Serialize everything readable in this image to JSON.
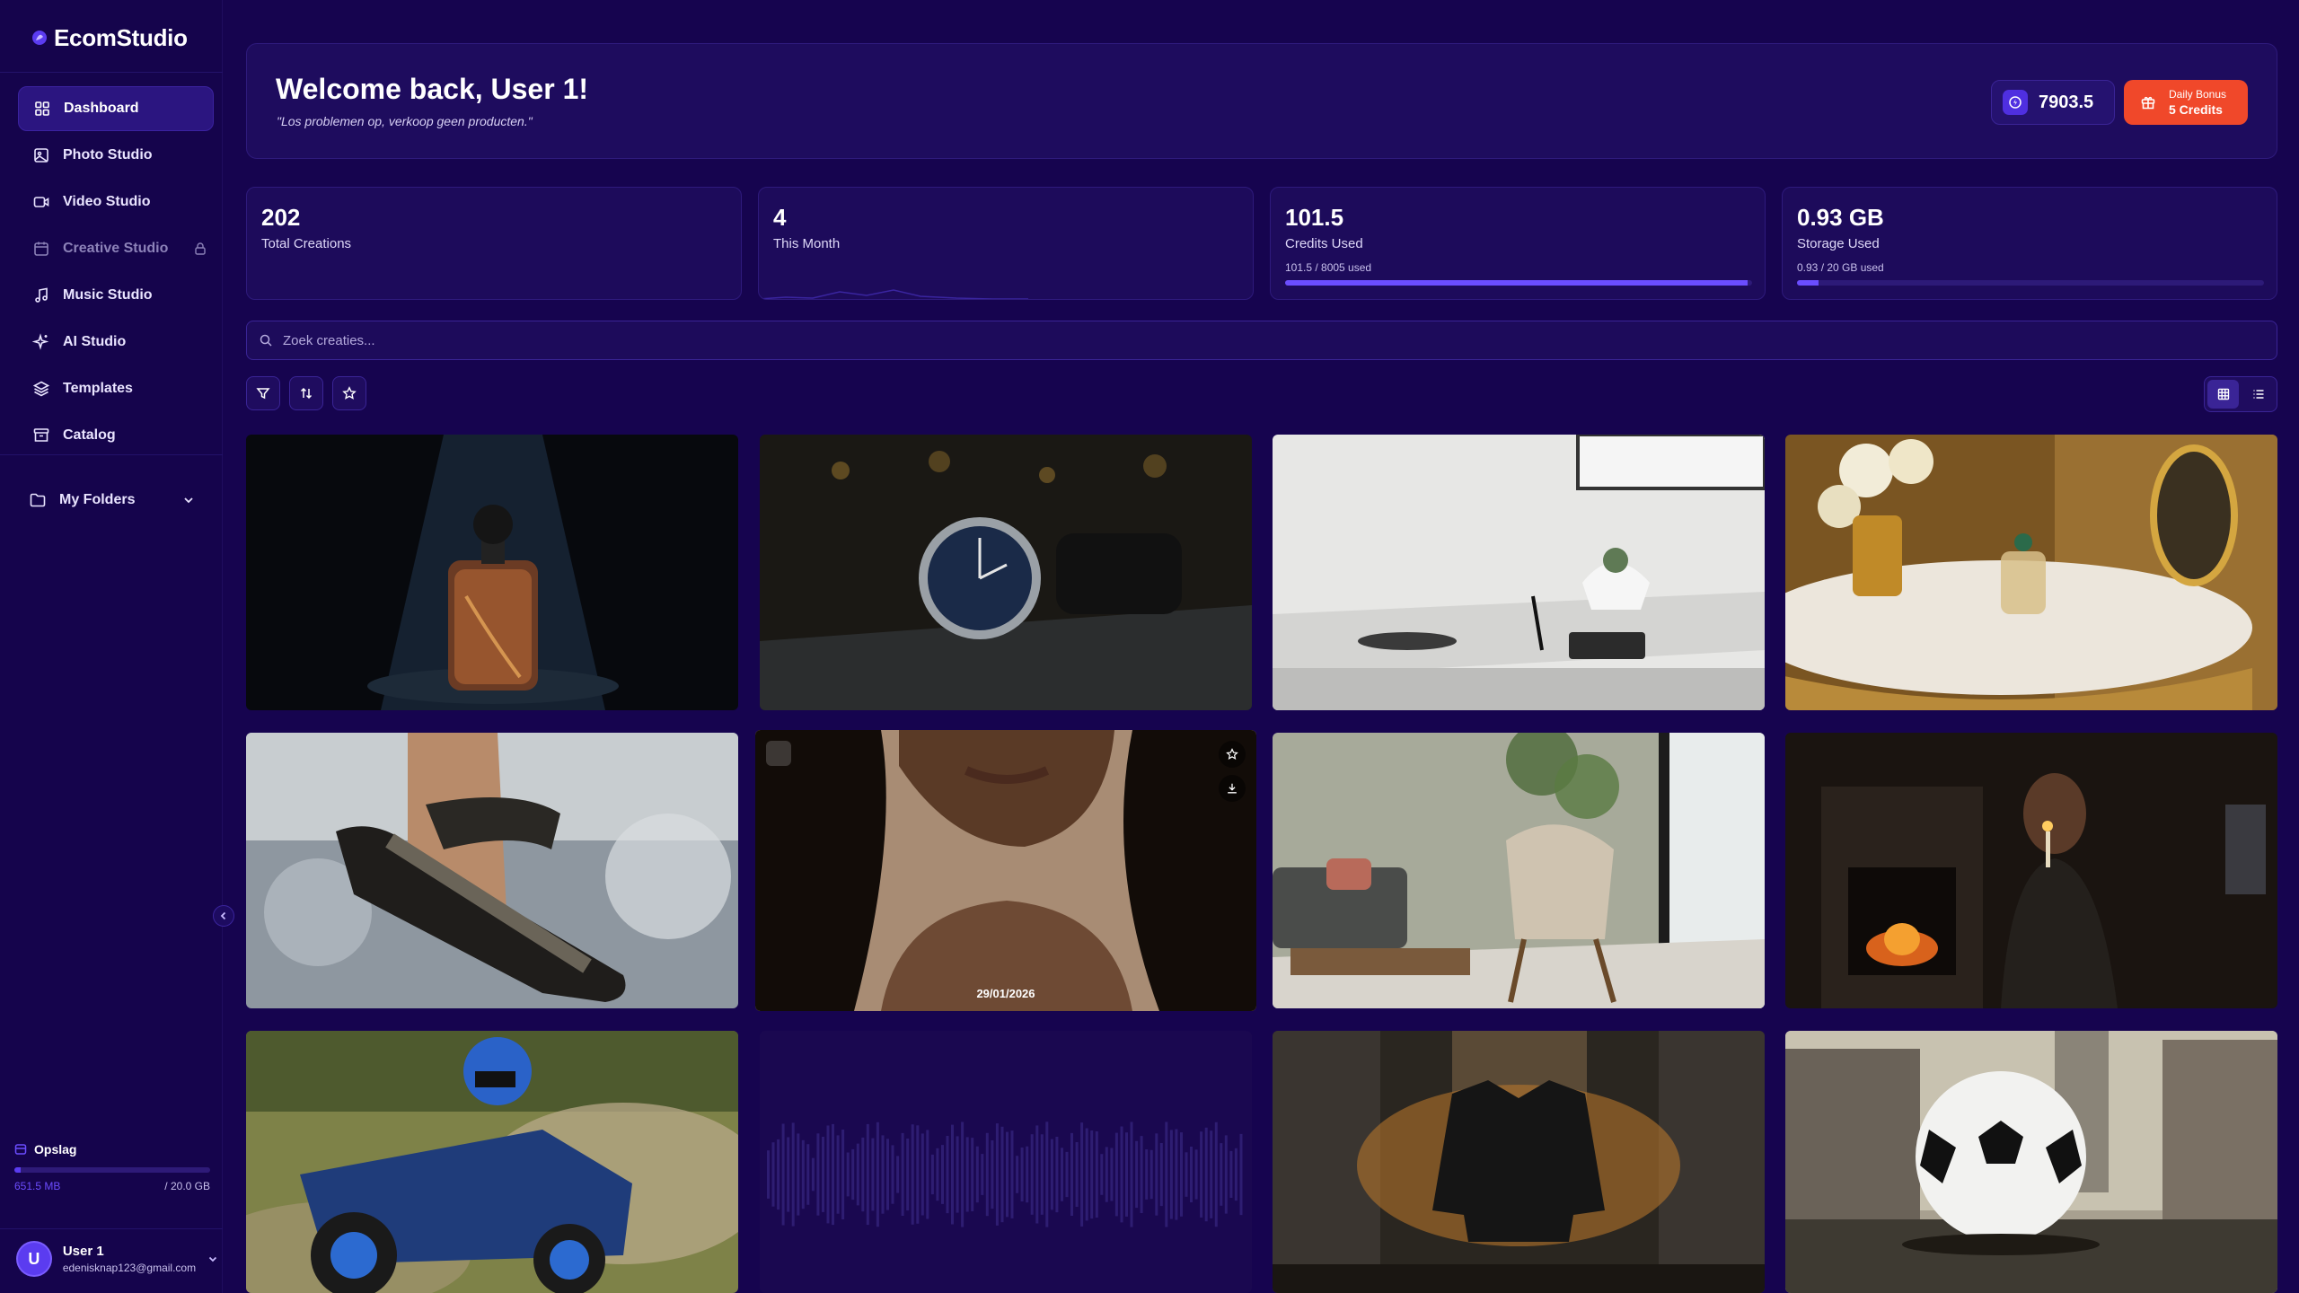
{
  "brand": {
    "name": "EcomStudio"
  },
  "nav": {
    "items": [
      {
        "label": "Dashboard",
        "icon": "grid-icon",
        "active": true
      },
      {
        "label": "Photo Studio",
        "icon": "image-icon"
      },
      {
        "label": "Video Studio",
        "icon": "video-icon"
      },
      {
        "label": "Creative Studio",
        "icon": "calendar-icon",
        "locked": true
      },
      {
        "label": "Music Studio",
        "icon": "music-icon"
      },
      {
        "label": "AI Studio",
        "icon": "sparkles-icon"
      },
      {
        "label": "Templates",
        "icon": "layers-icon"
      },
      {
        "label": "Catalog",
        "icon": "archive-icon"
      }
    ],
    "folders_label": "My Folders"
  },
  "storage": {
    "title": "Opslag",
    "used": "651.5 MB",
    "total": "/ 20.0 GB",
    "fraction": 0.032
  },
  "user": {
    "name": "User 1",
    "email": "edenisknap123@gmail.com",
    "initial": "U"
  },
  "header": {
    "welcome": "Welcome back, User 1!",
    "quote": "\"Los problemen op, verkoop geen producten.\"",
    "credits": "7903.5",
    "bonus_title": "Daily Bonus",
    "bonus_sub": "5 Credits"
  },
  "stats": [
    {
      "value": "202",
      "label": "Total Creations"
    },
    {
      "value": "4",
      "label": "This Month"
    },
    {
      "value": "101.5",
      "label": "Credits Used",
      "sub": "101.5 / 8005 used",
      "fraction": 0.99
    },
    {
      "value": "0.93 GB",
      "label": "Storage Used",
      "sub": "0.93 / 20 GB used",
      "fraction": 0.046
    }
  ],
  "search": {
    "placeholder": "Zoek creaties..."
  },
  "tiles": [
    {
      "name": "perfume-bottle-image"
    },
    {
      "name": "wristwatch-image"
    },
    {
      "name": "desk-setup-image"
    },
    {
      "name": "vanity-perfume-image"
    },
    {
      "name": "sandal-water-image"
    },
    {
      "name": "portrait-woman-image",
      "date": "29/01/2026"
    },
    {
      "name": "living-room-chair-image"
    },
    {
      "name": "woman-candle-image"
    },
    {
      "name": "buggy-rider-image"
    },
    {
      "name": "audio-waveform-tile"
    },
    {
      "name": "jacket-city-image"
    },
    {
      "name": "soccer-ball-city-image"
    }
  ],
  "colors": {
    "bg": "#16044f",
    "accent": "#5b3cf0",
    "bonus": "#f0482a"
  }
}
